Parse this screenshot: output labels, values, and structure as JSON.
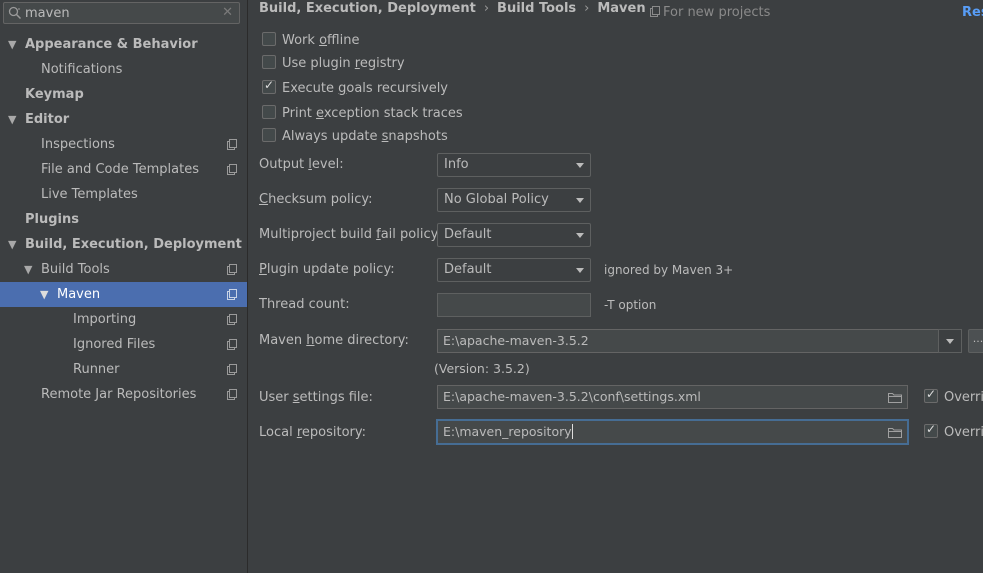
{
  "search": {
    "value": "maven"
  },
  "sidebar": {
    "items": [
      {
        "label": "Appearance & Behavior",
        "expanded": true
      },
      {
        "label": "Notifications"
      },
      {
        "label": "Keymap"
      },
      {
        "label": "Editor",
        "expanded": true
      },
      {
        "label": "Inspections"
      },
      {
        "label": "File and Code Templates"
      },
      {
        "label": "Live Templates"
      },
      {
        "label": "Plugins"
      },
      {
        "label": "Build, Execution, Deployment",
        "expanded": true
      },
      {
        "label": "Build Tools",
        "expanded": true
      },
      {
        "label": "Maven",
        "expanded": true,
        "selected": true
      },
      {
        "label": "Importing"
      },
      {
        "label": "Ignored Files"
      },
      {
        "label": "Runner"
      },
      {
        "label": "Remote Jar Repositories"
      }
    ]
  },
  "breadcrumb": {
    "items": [
      "Build, Execution, Deployment",
      "Build Tools",
      "Maven"
    ],
    "separator": "›",
    "scope_note": "For new projects",
    "reset_label": "Res"
  },
  "checkboxes": {
    "work_offline": {
      "label": "Work offline",
      "checked": false
    },
    "use_plugin_registry": {
      "label": "Use plugin registry",
      "checked": false
    },
    "execute_goals_recursively": {
      "label": "Execute goals recursively",
      "checked": true
    },
    "print_exception_stack_traces": {
      "label": "Print exception stack traces",
      "checked": false
    },
    "always_update_snapshots": {
      "label": "Always update snapshots",
      "checked": false
    }
  },
  "form": {
    "output_level": {
      "label": "Output level:",
      "value": "Info"
    },
    "checksum_policy": {
      "label": "Checksum policy:",
      "value": "No Global Policy"
    },
    "multiproject_fail_policy": {
      "label": "Multiproject build fail policy:",
      "value": "Default"
    },
    "plugin_update_policy": {
      "label": "Plugin update policy:",
      "value": "Default",
      "hint": "ignored by Maven 3+"
    },
    "thread_count": {
      "label": "Thread count:",
      "value": "",
      "hint": "-T option"
    },
    "maven_home": {
      "label": "Maven home directory:",
      "value": "E:\\apache-maven-3.5.2",
      "version": "(Version: 3.5.2)",
      "browse_label": "..."
    },
    "user_settings": {
      "label": "User settings file:",
      "value": "E:\\apache-maven-3.5.2\\conf\\settings.xml",
      "override_label": "Overrid",
      "override_checked": true
    },
    "local_repository": {
      "label": "Local repository:",
      "value": "E:\\maven_repository",
      "override_label": "Overrid",
      "override_checked": true
    }
  },
  "colors": {
    "background": "#3c3f41",
    "selection": "#4b6eaf",
    "link": "#589df6",
    "focus_border": "#466d94"
  }
}
